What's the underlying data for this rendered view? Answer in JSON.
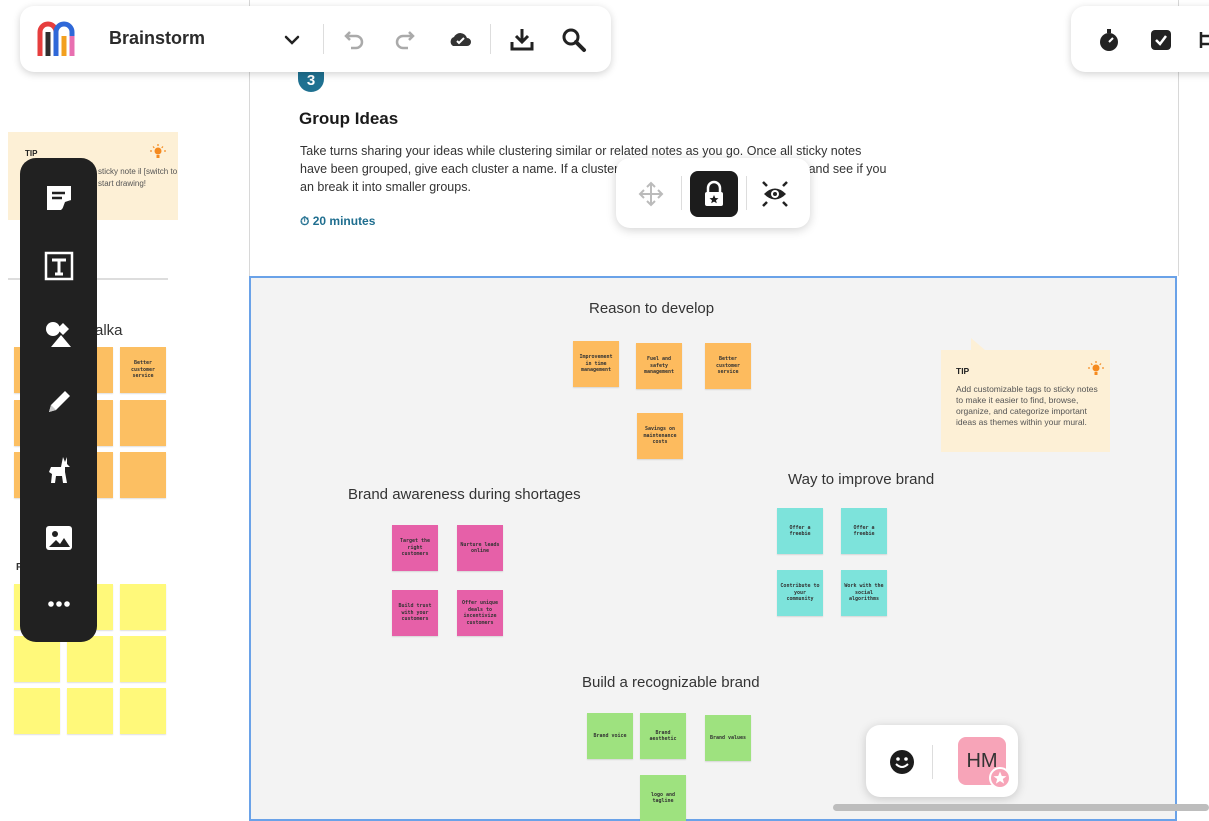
{
  "app": {
    "board_name": "Brainstorm",
    "brand_colors": [
      "#e63e3e",
      "#f2a01f",
      "#2f68d8",
      "#e86fb0"
    ]
  },
  "toolbar": {
    "icons": [
      "chevron-down-icon",
      "undo-icon",
      "redo-icon",
      "cloud-sync-icon",
      "download-icon",
      "search-icon"
    ],
    "right_icons": [
      "timer-icon",
      "checklist-icon",
      "more-icon"
    ]
  },
  "step": {
    "number": "3",
    "title": "Group Ideas",
    "description": "Take turns sharing your ideas while clustering similar or related notes as you go. Once all sticky notes have been grouped, give each cluster a name. If a cluster is bigger than six sticky notes, try and see if you an break it into smaller groups.",
    "time": "20 minutes"
  },
  "object_toolbar": {
    "icons": [
      "move-icon",
      "lock-icon",
      "focus-view-icon"
    ]
  },
  "left_panel": {
    "tip_label": "TIP",
    "tip_text": "sticky note il [switch to start drawing!",
    "heading": "alka",
    "p_label": "P",
    "notes_text": [
      "d",
      "h",
      "at",
      "Better customer service"
    ]
  },
  "tool_rail": {
    "tools": [
      "sticky-note-icon",
      "text-icon",
      "shapes-icon",
      "pen-icon",
      "llama-icon",
      "image-icon",
      "more-icon"
    ]
  },
  "clusters": [
    {
      "title": "Reason to develop",
      "notes": [
        "Improvement in time management",
        "Fuel and safety management",
        "Better customer service",
        "Savings on maintenance costs"
      ]
    },
    {
      "title": "Brand awareness during shortages",
      "notes": [
        "Target the right customers",
        "Nurture leads online",
        "Build trust with your customers",
        "Offer unique deals to incentivize customers"
      ]
    },
    {
      "title": "Way to improve brand",
      "notes": [
        "Offer a freebie",
        "Offer a freebie",
        "Contribute to your community",
        "Work with the social algorithms"
      ]
    },
    {
      "title": "Build a recognizable brand",
      "notes": [
        "Brand voice",
        "Brand aesthetic",
        "Brand values",
        "logo and tagline"
      ]
    }
  ],
  "right_tip": {
    "label": "TIP",
    "text": "Add customizable tags to sticky notes to make it easier to find, browse, organize, and categorize important ideas as themes within your mural."
  },
  "presence": {
    "avatar_initials": "HM",
    "reaction_icon": "smiley-icon"
  }
}
